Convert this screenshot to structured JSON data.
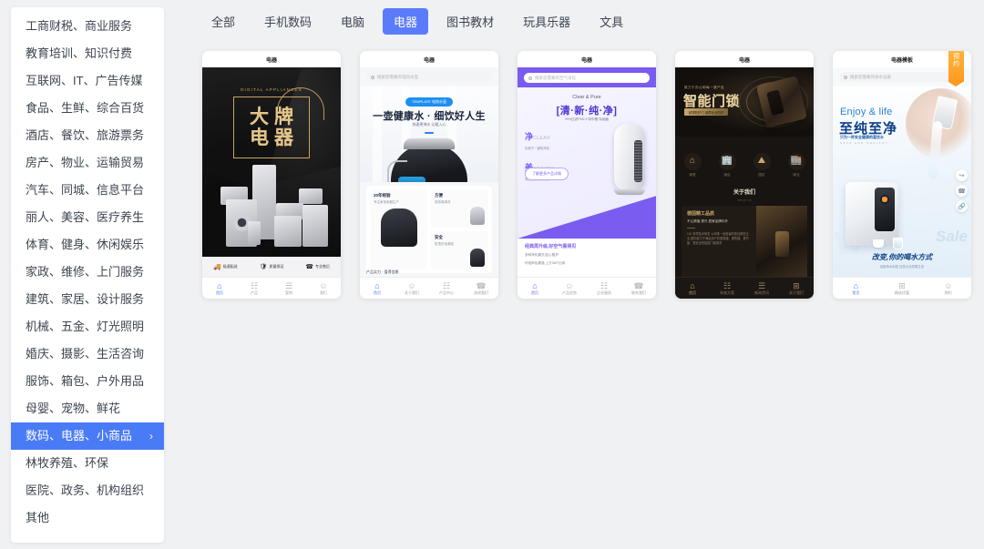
{
  "sidebar": {
    "items": [
      {
        "label": "工商财税、商业服务",
        "active": false
      },
      {
        "label": "教育培训、知识付费",
        "active": false
      },
      {
        "label": "互联网、IT、广告传媒",
        "active": false
      },
      {
        "label": "食品、生鲜、综合百货",
        "active": false
      },
      {
        "label": "酒店、餐饮、旅游票务",
        "active": false
      },
      {
        "label": "房产、物业、运输贸易",
        "active": false
      },
      {
        "label": "汽车、同城、信息平台",
        "active": false
      },
      {
        "label": "丽人、美容、医疗养生",
        "active": false
      },
      {
        "label": "体育、健身、休闲娱乐",
        "active": false
      },
      {
        "label": "家政、维修、上门服务",
        "active": false
      },
      {
        "label": "建筑、家居、设计服务",
        "active": false
      },
      {
        "label": "机械、五金、灯光照明",
        "active": false
      },
      {
        "label": "婚庆、摄影、生活咨询",
        "active": false
      },
      {
        "label": "服饰、箱包、户外用品",
        "active": false
      },
      {
        "label": "母婴、宠物、鲜花",
        "active": false
      },
      {
        "label": "数码、电器、小商品",
        "active": true,
        "chevron": "›"
      },
      {
        "label": "林牧养殖、环保",
        "active": false
      },
      {
        "label": "医院、政务、机构组织",
        "active": false
      },
      {
        "label": "其他",
        "active": false
      }
    ]
  },
  "tabs": [
    {
      "label": "全部",
      "active": false
    },
    {
      "label": "手机数码",
      "active": false
    },
    {
      "label": "电脑",
      "active": false
    },
    {
      "label": "电器",
      "active": true
    },
    {
      "label": "图书教材",
      "active": false
    },
    {
      "label": "玩具乐器",
      "active": false
    },
    {
      "label": "文具",
      "active": false
    }
  ],
  "colors": {
    "page_bg": "#f0f1f3",
    "accent_blue": "#4a7bf7",
    "tab_active": "#5b7cfa",
    "purple": "#7a5cf0",
    "gold": "#c9a86a",
    "orange": "#ff9a1f"
  },
  "cards": [
    {
      "header": "电器",
      "hero": {
        "eng": "DIGITAL APPLIANCES",
        "line1": "大牌",
        "line2": "电器"
      },
      "features": [
        {
          "icon": "truck-icon",
          "glyph": "🚚",
          "label": "极速配送"
        },
        {
          "icon": "shield-icon",
          "glyph": "🛡",
          "label": "质量保证"
        },
        {
          "icon": "headset-icon",
          "glyph": "☎",
          "label": "专业售后"
        }
      ],
      "tabbar": [
        {
          "glyph": "⌂",
          "label": "首页",
          "active": true
        },
        {
          "glyph": "☷",
          "label": "产品",
          "active": false
        },
        {
          "glyph": "☰",
          "label": "案例",
          "active": false
        },
        {
          "glyph": "☺",
          "label": "我们",
          "active": false
        }
      ]
    },
    {
      "header": "电器",
      "search_placeholder": "搜索您需要的电热水壶",
      "hero": {
        "badge": "TEMPLATE 电热水壶",
        "title": "一壶健康水 · 细饮好人生",
        "sub": "快速煮沸水 沁暖入心"
      },
      "cells": [
        {
          "h": "20年经验",
          "p": "专注家电电器生产"
        },
        {
          "h": "方便",
          "p": "快拆易清洗"
        },
        {
          "h": "安全",
          "p": "防烫伤电源线"
        }
      ],
      "foot": "产品实力 · 值得信赖",
      "tabbar": [
        {
          "glyph": "⌂",
          "label": "首页",
          "active": true
        },
        {
          "glyph": "☺",
          "label": "关于我们",
          "active": false
        },
        {
          "glyph": "☷",
          "label": "产品中心",
          "active": false
        },
        {
          "glyph": "☎",
          "label": "咨询我们",
          "active": false
        }
      ]
    },
    {
      "header": "电器",
      "search_placeholder": "搜索您需要的空气净化",
      "hero": {
        "eng": "Clear & Pure",
        "title": "[清·新·纯·净]",
        "sub": "99%过滤PM2.5 除甲醛 除细菌"
      },
      "features": [
        {
          "big": "净",
          "en": "CLEAR",
          "d": "负离子一键除净化"
        },
        {
          "big": "美",
          "en": "BEAUTY",
          "d": "简洁机身设计美化"
        }
      ],
      "button": "了解更多产品详情",
      "bottom": {
        "h": "经典再升级,好空气看得见",
        "l1": "多种净化模式,贴心照护",
        "l2": "环绕声包裹感,上方360°出风"
      },
      "tabbar": [
        {
          "glyph": "⌂",
          "label": "首页",
          "active": true
        },
        {
          "glyph": "☺",
          "label": "产品优势",
          "active": false
        },
        {
          "glyph": "☷",
          "label": "企业服务",
          "active": false
        },
        {
          "glyph": "☎",
          "label": "联系我们",
          "active": false
        }
      ]
    },
    {
      "header": "电器",
      "hero": {
        "kicker": "致力于办公和每一道产品",
        "title": "智能门锁",
        "tag": "超薄防护门 保障安全防护"
      },
      "icons": [
        {
          "glyph": "⌂",
          "label": "家居"
        },
        {
          "glyph": "🏢",
          "label": "酒店"
        },
        {
          "glyph": "⛰",
          "label": "园区"
        },
        {
          "glyph": "🏬",
          "label": "商业"
        }
      ],
      "about": {
        "title": "关于我们",
        "eng": "ABOUT US"
      },
      "panel": {
        "h": "德国精工品质",
        "s": "不止颜值 提升 居家品牌中外",
        "p": "100 多项技术研发 公司唯一经营者即是创新型企业,国内致力于满足用户的更便捷、更快捷、更节能、更安全的智能门锁需求"
      },
      "tabbar": [
        {
          "glyph": "⌂",
          "label": "首页",
          "active": true
        },
        {
          "glyph": "☷",
          "label": "系统方案",
          "active": false
        },
        {
          "glyph": "☰",
          "label": "新闻资讯",
          "active": false
        },
        {
          "glyph": "⊞",
          "label": "关于我们",
          "active": false
        }
      ]
    },
    {
      "header": "电器模板",
      "ribbon": [
        "预",
        "约"
      ],
      "search_placeholder": "搜索您需要的净水设备",
      "hero": {
        "eng": "Enjoy & life",
        "title": "至纯至净",
        "sub": "只为一杯安全健康的直饮水",
        "sub2": "SAFE AND HEALTHY",
        "watermark1": "Sale",
        "watermark2": "W",
        "cta": "改变,你的喝水方式",
        "cta2": "创新净水科技 还您大自然原生态"
      },
      "float_buttons": [
        {
          "icon": "share-icon",
          "glyph": "↪"
        },
        {
          "icon": "phone-icon",
          "glyph": "☎"
        },
        {
          "icon": "link-icon",
          "glyph": "🔗"
        }
      ],
      "tabbar": [
        {
          "glyph": "⌂",
          "label": "首页",
          "active": true
        },
        {
          "glyph": "⊞",
          "label": "精选优惠",
          "active": false
        },
        {
          "glyph": "☺",
          "label": "预约",
          "active": false
        }
      ]
    }
  ]
}
